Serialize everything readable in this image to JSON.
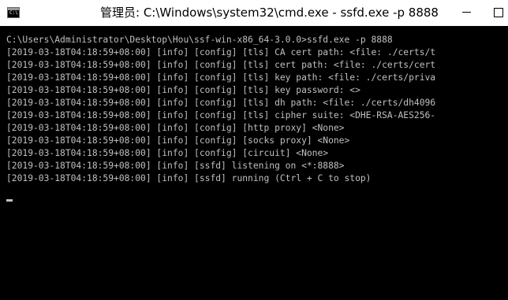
{
  "window": {
    "title": "管理员: C:\\Windows\\system32\\cmd.exe - ssfd.exe  -p 8888",
    "icon": "cmd-icon",
    "icon_prompt": "C:\\"
  },
  "console": {
    "lines": [
      "C:\\Users\\Administrator\\Desktop\\Hou\\ssf-win-x86_64-3.0.0>ssfd.exe -p 8888",
      "[2019-03-18T04:18:59+08:00] [info] [config] [tls] CA cert path: <file: ./certs/t",
      "[2019-03-18T04:18:59+08:00] [info] [config] [tls] cert path: <file: ./certs/cert",
      "[2019-03-18T04:18:59+08:00] [info] [config] [tls] key path: <file: ./certs/priva",
      "[2019-03-18T04:18:59+08:00] [info] [config] [tls] key password: <>",
      "[2019-03-18T04:18:59+08:00] [info] [config] [tls] dh path: <file: ./certs/dh4096",
      "[2019-03-18T04:18:59+08:00] [info] [config] [tls] cipher suite: <DHE-RSA-AES256-",
      "[2019-03-18T04:18:59+08:00] [info] [config] [http proxy] <None>",
      "[2019-03-18T04:18:59+08:00] [info] [config] [socks proxy] <None>",
      "[2019-03-18T04:18:59+08:00] [info] [config] [circuit] <None>",
      "[2019-03-18T04:18:59+08:00] [info] [ssfd] listening on <*:8888>",
      "[2019-03-18T04:18:59+08:00] [info] [ssfd] running (Ctrl + C to stop)"
    ]
  }
}
